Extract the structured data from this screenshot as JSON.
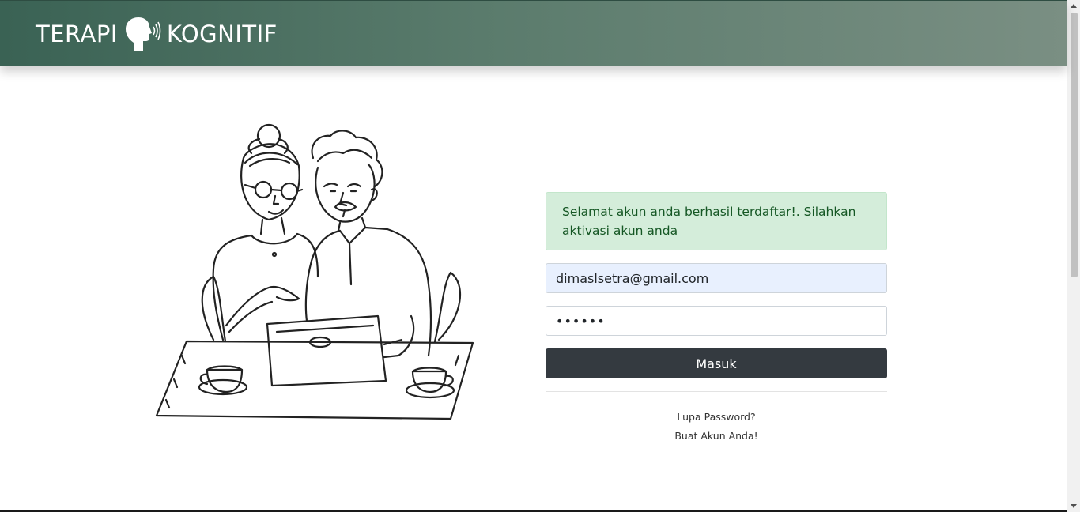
{
  "header": {
    "brand_left": "TERAPI",
    "brand_right": "KOGNITIF",
    "icon": "speaking-head-icon"
  },
  "illustration": {
    "icon": "elderly-couple-laptop-illustration"
  },
  "alert": {
    "message": "Selamat akun anda berhasil terdaftar!. Silahkan aktivasi akun anda",
    "color": "#155724",
    "background": "#d4edda"
  },
  "login_form": {
    "email_value": "dimaslsetra@gmail.com",
    "password_value": "••••••",
    "submit_label": "Masuk",
    "submit_color": "#343a40"
  },
  "links": {
    "forgot_password": "Lupa Password?",
    "create_account": "Buat Akun Anda!"
  },
  "colors": {
    "header_start": "#3a6254",
    "header_end": "#7a8f83"
  }
}
